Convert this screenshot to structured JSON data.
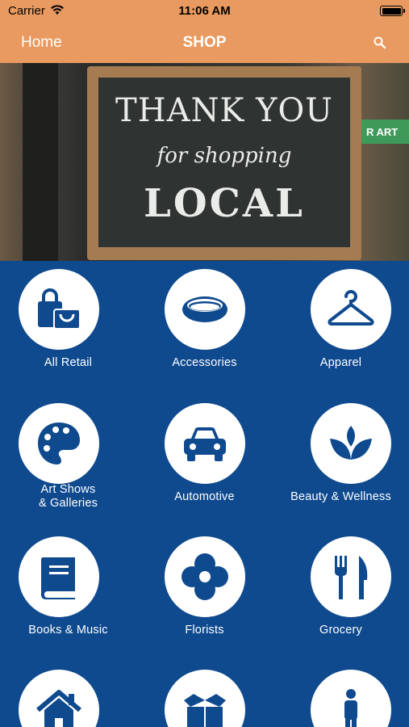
{
  "status_bar": {
    "carrier": "Carrier",
    "time": "11:06 AM"
  },
  "nav": {
    "back_label": "Home",
    "title": "SHOP"
  },
  "hero": {
    "line1": "THANK YOU",
    "line2": "for shopping",
    "line3": "LOCAL",
    "side_sign": "R ART"
  },
  "categories": [
    {
      "label": "All Retail",
      "icon": "shopping-bags-icon"
    },
    {
      "label": "Accessories",
      "icon": "ring-icon"
    },
    {
      "label": "Apparel",
      "icon": "hanger-icon"
    },
    {
      "label": "Art Shows\n& Galleries",
      "icon": "palette-icon"
    },
    {
      "label": "Automotive",
      "icon": "car-icon"
    },
    {
      "label": "Beauty & Wellness",
      "icon": "lotus-icon"
    },
    {
      "label": "Books & Music",
      "icon": "book-icon"
    },
    {
      "label": "Florists",
      "icon": "flower-icon"
    },
    {
      "label": "Grocery",
      "icon": "fork-knife-icon"
    },
    {
      "label": "",
      "icon": "house-icon"
    },
    {
      "label": "",
      "icon": "box-icon"
    },
    {
      "label": "",
      "icon": "person-icon"
    }
  ],
  "colors": {
    "bar": "#e89a60",
    "grid_bg": "#0f4a8e",
    "icon": "#0f4a8e",
    "circle": "#ffffff"
  }
}
